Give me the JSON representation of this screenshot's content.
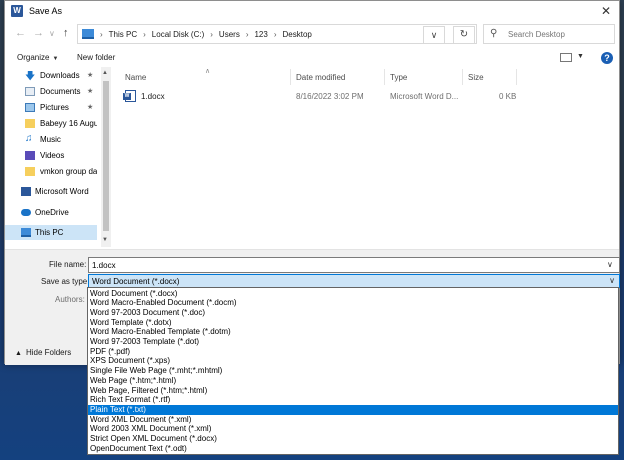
{
  "window": {
    "title": "Save As",
    "close_symbol": "✕"
  },
  "address_bar": {
    "crumbs": [
      "This PC",
      "Local Disk (C:)",
      "Users",
      "123",
      "Desktop"
    ]
  },
  "search": {
    "placeholder": "Search Desktop"
  },
  "toolbar": {
    "organize_label": "Organize",
    "new_folder_label": "New folder"
  },
  "nav_pane": {
    "items": [
      {
        "label": "Downloads",
        "pinned": true
      },
      {
        "label": "Documents",
        "pinned": true
      },
      {
        "label": "Pictures",
        "pinned": true
      },
      {
        "label": "Babeyy 16 Augu",
        "pinned": false
      },
      {
        "label": "Music",
        "pinned": false
      },
      {
        "label": "Videos",
        "pinned": false
      },
      {
        "label": "vmkon group da",
        "pinned": false
      },
      {
        "label": "Microsoft Word",
        "pinned": false
      },
      {
        "label": "OneDrive",
        "pinned": false
      },
      {
        "label": "This PC",
        "pinned": false,
        "selected": true
      }
    ]
  },
  "file_list": {
    "columns": [
      "Name",
      "Date modified",
      "Type",
      "Size"
    ],
    "rows": [
      {
        "name": "1.docx",
        "date_modified": "8/16/2022 3:02 PM",
        "type": "Microsoft Word D...",
        "size": "0 KB"
      }
    ]
  },
  "form": {
    "file_name_label": "File name:",
    "file_name_value": "1.docx",
    "save_as_type_label": "Save as type:",
    "save_as_type_value": "Word Document (*.docx)",
    "authors_label": "Authors:",
    "hide_folders_label": "Hide Folders"
  },
  "save_type_options": [
    "Word Document (*.docx)",
    "Word Macro-Enabled Document (*.docm)",
    "Word 97-2003 Document (*.doc)",
    "Word Template (*.dotx)",
    "Word Macro-Enabled Template (*.dotm)",
    "Word 97-2003 Template (*.dot)",
    "PDF (*.pdf)",
    "XPS Document (*.xps)",
    "Single File Web Page (*.mht;*.mhtml)",
    "Web Page (*.htm;*.html)",
    "Web Page, Filtered (*.htm;*.html)",
    "Rich Text Format (*.rtf)",
    "Plain Text (*.txt)",
    "Word XML Document (*.xml)",
    "Word 2003 XML Document (*.xml)",
    "Strict Open XML Document (*.docx)",
    "OpenDocument Text (*.odt)"
  ],
  "highlighted_option": "Plain Text (*.txt)",
  "colors": {
    "accent": "#0078d7",
    "selection": "#cce4f7",
    "word_brand": "#2b579a"
  }
}
